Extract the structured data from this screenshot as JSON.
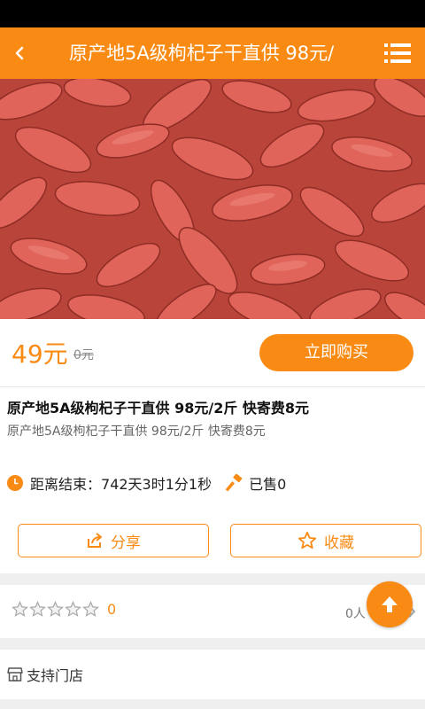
{
  "header": {
    "title": "原产地5A级枸杞子干直供 98元/"
  },
  "hero": {
    "image_icon": "goji-berries-photo"
  },
  "price_panel": {
    "price": "49元",
    "old_price": "0元",
    "buy_label": "立即购买"
  },
  "product": {
    "title": "原产地5A级枸杞子干直供 98元/2斤 快寄费8元",
    "subtitle": "原产地5A级枸杞子干直供 98元/2斤 快寄费8元"
  },
  "timer": {
    "label": "距离结束：",
    "value": "742天3时1分1秒",
    "sold": "已售0"
  },
  "actions": {
    "share_label": "分享",
    "favorite_label": "收藏"
  },
  "rating": {
    "stars": 0,
    "max_stars": 5,
    "count": "0",
    "people": "0人"
  },
  "store": {
    "label": "支持门店"
  },
  "colors": {
    "accent": "#f98b14",
    "status_bar": "#000000",
    "background": "#efefef"
  }
}
